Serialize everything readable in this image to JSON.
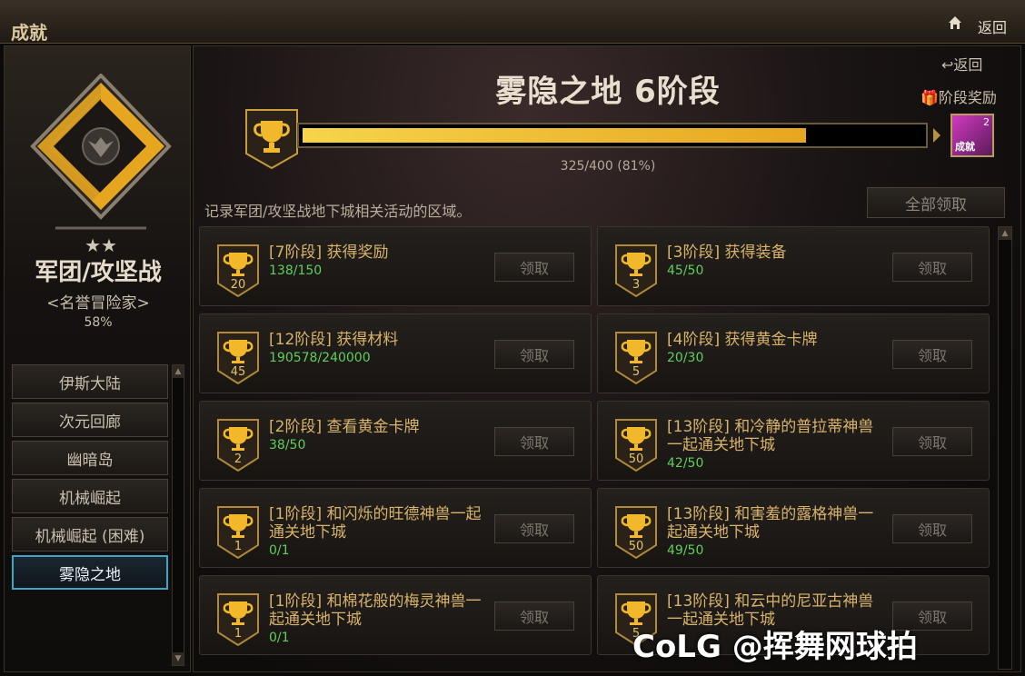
{
  "window": {
    "title": "成就",
    "back_label": "返回"
  },
  "sidebar": {
    "category_title": "军团/攻坚战",
    "category_subtitle": "<名誉冒险家>",
    "category_percent": "58%",
    "items": [
      {
        "label": "伊斯大陆",
        "active": false
      },
      {
        "label": "次元回廊",
        "active": false
      },
      {
        "label": "幽暗岛",
        "active": false
      },
      {
        "label": "机械崛起",
        "active": false
      },
      {
        "label": "机械崛起 (困难)",
        "active": false
      },
      {
        "label": "雾隐之地",
        "active": true
      }
    ]
  },
  "main": {
    "zone_title": "雾隐之地 6阶段",
    "back_link": "返回",
    "stage_reward_label": "阶段奖励",
    "reward": {
      "count": "2",
      "label": "成就"
    },
    "progress": {
      "text": "325/400 (81%)",
      "fraction": 0.8125
    },
    "description": "记录军团/攻坚战地下城相关活动的区域。",
    "claim_all_label": "全部领取",
    "achievements": [
      {
        "title": "[7阶段] 获得奖励",
        "progress": "138/150",
        "badge": "20",
        "claim": "领取"
      },
      {
        "title": "[3阶段] 获得装备",
        "progress": "45/50",
        "badge": "3",
        "claim": "领取"
      },
      {
        "title": "[12阶段] 获得材料",
        "progress": "190578/240000",
        "badge": "45",
        "claim": "领取"
      },
      {
        "title": "[4阶段] 获得黄金卡牌",
        "progress": "20/30",
        "badge": "5",
        "claim": "领取"
      },
      {
        "title": "[2阶段] 查看黄金卡牌",
        "progress": "38/50",
        "badge": "2",
        "claim": "领取"
      },
      {
        "title": "[13阶段] 和冷静的普拉蒂神兽一起通关地下城",
        "progress": "42/50",
        "badge": "50",
        "claim": "领取"
      },
      {
        "title": "[1阶段] 和闪烁的旺德神兽一起通关地下城",
        "progress": "0/1",
        "badge": "1",
        "claim": "领取"
      },
      {
        "title": "[13阶段] 和害羞的露格神兽一起通关地下城",
        "progress": "49/50",
        "badge": "50",
        "claim": "领取"
      },
      {
        "title": "[1阶段] 和棉花般的梅灵神兽一起通关地下城",
        "progress": "0/1",
        "badge": "1",
        "claim": "领取"
      },
      {
        "title": "[13阶段] 和云中的尼亚古神兽一起通关地下城",
        "progress": "",
        "badge": "5",
        "claim": "领取"
      }
    ]
  },
  "watermark": "CoLG @挥舞网球拍"
}
